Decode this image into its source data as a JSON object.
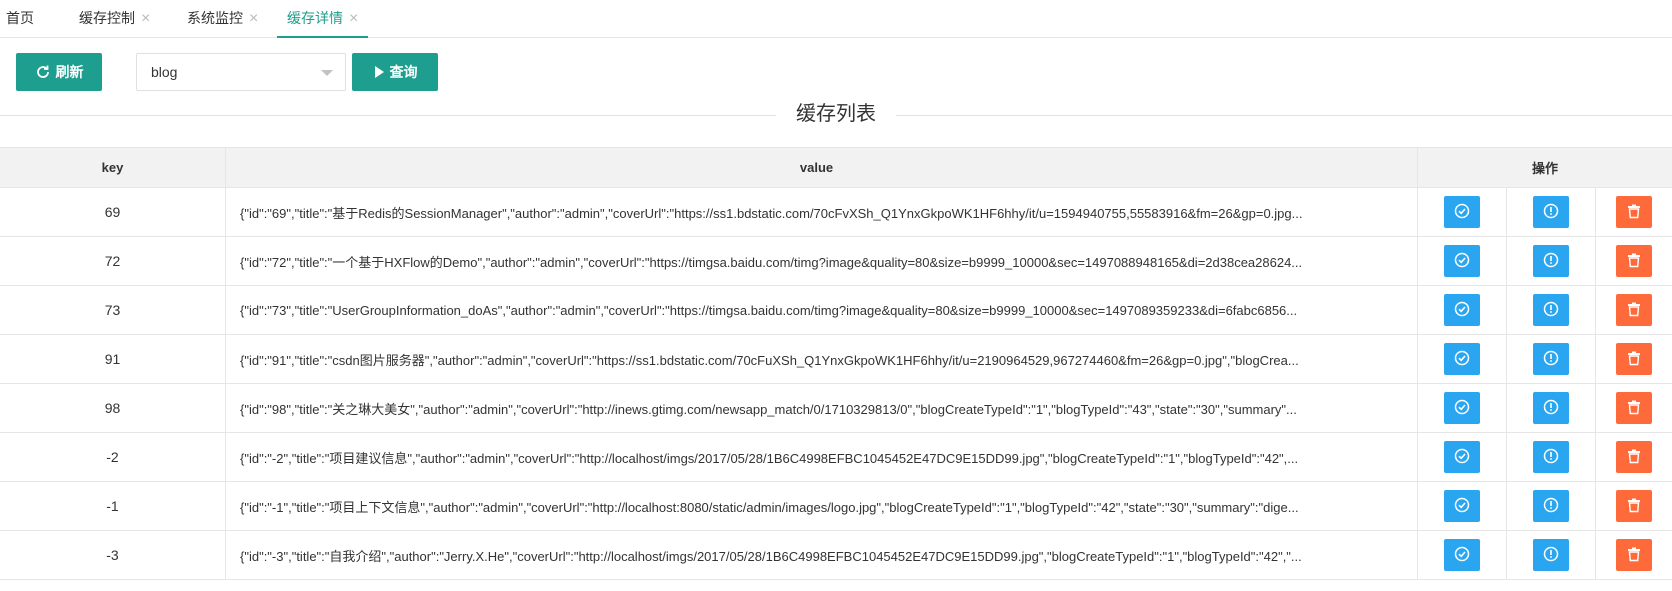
{
  "tabs": [
    {
      "label": "首页",
      "closable": false,
      "active": false
    },
    {
      "label": "缓存控制",
      "closable": true,
      "active": false
    },
    {
      "label": "系统监控",
      "closable": true,
      "active": false
    },
    {
      "label": "缓存详情",
      "closable": true,
      "active": true
    }
  ],
  "toolbar": {
    "refresh_label": "刷新",
    "select_value": "blog",
    "query_label": "查询"
  },
  "section_title": "缓存列表",
  "table": {
    "headers": {
      "key": "key",
      "value": "value",
      "ops": "操作"
    },
    "rows": [
      {
        "key": "69",
        "value": "{\"id\":\"69\",\"title\":\"基于Redis的SessionManager\",\"author\":\"admin\",\"coverUrl\":\"https://ss1.bdstatic.com/70cFvXSh_Q1YnxGkpoWK1HF6hhy/it/u=1594940755,55583916&fm=26&gp=0.jpg..."
      },
      {
        "key": "72",
        "value": "{\"id\":\"72\",\"title\":\"一个基于HXFlow的Demo\",\"author\":\"admin\",\"coverUrl\":\"https://timgsa.baidu.com/timg?image&quality=80&size=b9999_10000&sec=1497088948165&di=2d38cea28624..."
      },
      {
        "key": "73",
        "value": "{\"id\":\"73\",\"title\":\"UserGroupInformation_doAs\",\"author\":\"admin\",\"coverUrl\":\"https://timgsa.baidu.com/timg?image&quality=80&size=b9999_10000&sec=1497089359233&di=6fabc6856..."
      },
      {
        "key": "91",
        "value": "{\"id\":\"91\",\"title\":\"csdn图片服务器\",\"author\":\"admin\",\"coverUrl\":\"https://ss1.bdstatic.com/70cFuXSh_Q1YnxGkpoWK1HF6hhy/it/u=2190964529,967274460&fm=26&gp=0.jpg\",\"blogCrea..."
      },
      {
        "key": "98",
        "value": "{\"id\":\"98\",\"title\":\"关之琳大美女\",\"author\":\"admin\",\"coverUrl\":\"http://inews.gtimg.com/newsapp_match/0/1710329813/0\",\"blogCreateTypeId\":\"1\",\"blogTypeId\":\"43\",\"state\":\"30\",\"summary\"..."
      },
      {
        "key": "-2",
        "value": "{\"id\":\"-2\",\"title\":\"项目建议信息\",\"author\":\"admin\",\"coverUrl\":\"http://localhost/imgs/2017/05/28/1B6C4998EFBC1045452E47DC9E15DD99.jpg\",\"blogCreateTypeId\":\"1\",\"blogTypeId\":\"42\",..."
      },
      {
        "key": "-1",
        "value": "{\"id\":\"-1\",\"title\":\"项目上下文信息\",\"author\":\"admin\",\"coverUrl\":\"http://localhost:8080/static/admin/images/logo.jpg\",\"blogCreateTypeId\":\"1\",\"blogTypeId\":\"42\",\"state\":\"30\",\"summary\":\"dige..."
      },
      {
        "key": "-3",
        "value": "{\"id\":\"-3\",\"title\":\"自我介绍\",\"author\":\"Jerry.X.He\",\"coverUrl\":\"http://localhost/imgs/2017/05/28/1B6C4998EFBC1045452E47DC9E15DD99.jpg\",\"blogCreateTypeId\":\"1\",\"blogTypeId\":\"42\",\"..."
      }
    ]
  },
  "icons": {
    "refresh": "refresh-icon",
    "play": "play-icon",
    "row_action_1": "check-circle-icon",
    "row_action_2": "info-circle-icon",
    "row_action_3": "trash-icon"
  },
  "colors": {
    "primary": "#1e9e8f",
    "blue": "#2aa6f0",
    "orange": "#ff6a3b"
  }
}
